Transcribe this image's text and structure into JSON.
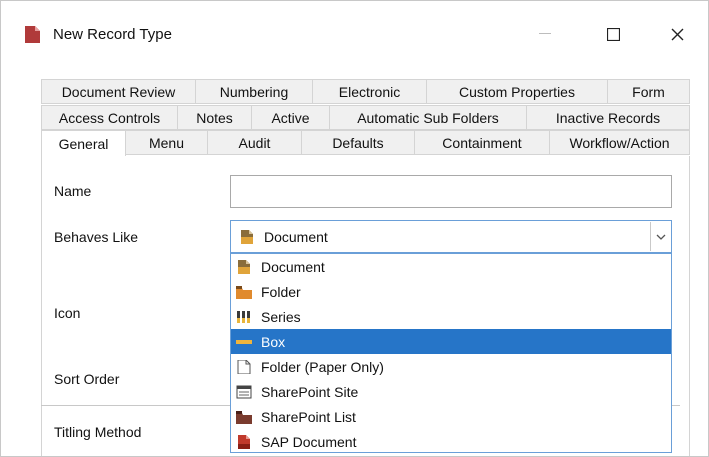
{
  "window": {
    "title": "New Record Type",
    "title_icon": "record-type-icon",
    "controls": {
      "minimize": "—",
      "maximize": "☐",
      "close": "✕"
    }
  },
  "tabs": {
    "row1": [
      "Document Review",
      "Numbering",
      "Electronic",
      "Custom Properties",
      "Form"
    ],
    "row2": [
      "Access Controls",
      "Notes",
      "Active",
      "Automatic Sub Folders",
      "Inactive Records"
    ],
    "row3": [
      "General",
      "Menu",
      "Audit",
      "Defaults",
      "Containment",
      "Workflow/Action"
    ],
    "active": "General"
  },
  "form": {
    "name_label": "Name",
    "name_value": "",
    "behaves_like_label": "Behaves Like",
    "behaves_like_value": "Document",
    "icon_label": "Icon",
    "sort_order_label": "Sort Order",
    "titling_method_label": "Titling Method"
  },
  "dropdown": {
    "options": [
      "Document",
      "Folder",
      "Series",
      "Box",
      "Folder (Paper Only)",
      "SharePoint Site",
      "SharePoint List",
      "SAP Document"
    ],
    "highlighted": "Box"
  },
  "colors": {
    "selection": "#2675c8",
    "focus_border": "#6a9fd8",
    "document_red": "#c0392b",
    "folder_orange": "#e08a2e",
    "box_yellow": "#f0b43c"
  }
}
